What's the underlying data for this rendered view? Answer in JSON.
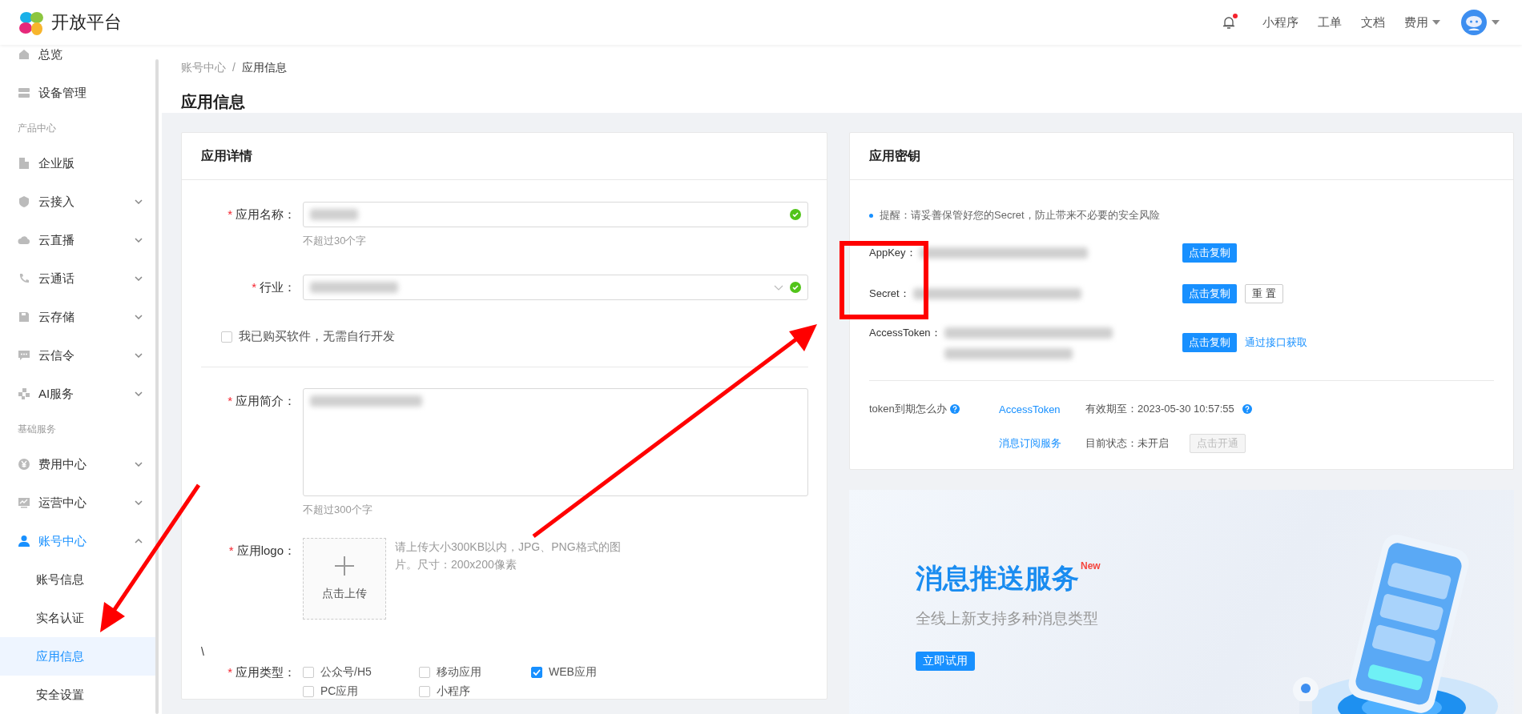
{
  "header": {
    "logo_text": "开放平台",
    "bell": {
      "unread": true
    },
    "nav": [
      {
        "label": "小程序",
        "dropdown": false
      },
      {
        "label": "工单",
        "dropdown": false
      },
      {
        "label": "文档",
        "dropdown": false
      },
      {
        "label": "费用",
        "dropdown": true
      }
    ],
    "avatar": {
      "dropdown": true
    }
  },
  "sidebar": {
    "items": [
      {
        "kind": "item",
        "label": "总览"
      },
      {
        "kind": "item",
        "label": "设备管理"
      },
      {
        "kind": "section",
        "label": "产品中心"
      },
      {
        "kind": "item",
        "label": "企业版"
      },
      {
        "kind": "item",
        "label": "云接入",
        "expanded": false
      },
      {
        "kind": "item",
        "label": "云直播",
        "expanded": false
      },
      {
        "kind": "item",
        "label": "云通话",
        "expanded": false
      },
      {
        "kind": "item",
        "label": "云存储",
        "expanded": false
      },
      {
        "kind": "item",
        "label": "云信令",
        "expanded": false
      },
      {
        "kind": "item",
        "label": "AI服务",
        "expanded": false
      },
      {
        "kind": "section",
        "label": "基础服务"
      },
      {
        "kind": "item",
        "label": "费用中心",
        "expanded": false
      },
      {
        "kind": "item",
        "label": "运营中心",
        "expanded": false
      },
      {
        "kind": "item",
        "label": "账号中心",
        "expanded": true,
        "children": [
          {
            "label": "账号信息",
            "selected": false
          },
          {
            "label": "实名认证",
            "selected": false
          },
          {
            "label": "应用信息",
            "selected": true
          },
          {
            "label": "安全设置",
            "selected": false
          }
        ]
      }
    ]
  },
  "breadcrumb": {
    "items": [
      "账号中心",
      "应用信息"
    ],
    "separator": "/"
  },
  "page_title": "应用信息",
  "app_details": {
    "title": "应用详情",
    "name_field": {
      "required_mark": "*",
      "label": "应用名称：",
      "valid": true,
      "hint": "不超过30个字"
    },
    "industry_field": {
      "required_mark": "*",
      "label": "行业：",
      "valid": true
    },
    "purchased": {
      "label": "我已购买软件，无需自行开发",
      "checked": false
    },
    "intro_field": {
      "required_mark": "*",
      "label": "应用简介：",
      "hint": "不超过300个字"
    },
    "logo_field": {
      "required_mark": "*",
      "label": "应用logo：",
      "upload_label": "点击上传",
      "hint": "请上传大小300KB以内，JPG、PNG格式的图片。尺寸：200x200像素"
    },
    "stray_text": "\\",
    "type_field": {
      "required_mark": "*",
      "label": "应用类型：",
      "options": [
        {
          "label": "公众号/H5",
          "checked": false
        },
        {
          "label": "移动应用",
          "checked": false
        },
        {
          "label": "WEB应用",
          "checked": true
        },
        {
          "label": "PC应用",
          "checked": false
        },
        {
          "label": "小程序",
          "checked": false
        }
      ]
    }
  },
  "app_keys": {
    "title": "应用密钥",
    "notice": "提醒：请妥善保管好您的Secret，防止带来不必要的安全风险",
    "rows": [
      {
        "label": "AppKey：",
        "actions": [
          {
            "kind": "primary",
            "label": "点击复制"
          }
        ]
      },
      {
        "label": "Secret：",
        "actions": [
          {
            "kind": "primary",
            "label": "点击复制"
          },
          {
            "kind": "default",
            "label": "重 置"
          }
        ]
      },
      {
        "label": "AccessToken：",
        "actions": [
          {
            "kind": "primary",
            "label": "点击复制"
          },
          {
            "kind": "link",
            "label": "通过接口获取"
          }
        ]
      }
    ],
    "token": {
      "question": "token到期怎么办",
      "question_help": true,
      "services": [
        {
          "name": "AccessToken",
          "status": "有效期至：2023-05-30 10:57:55",
          "help": true
        },
        {
          "name": "消息订阅服务",
          "status": "目前状态：未开启",
          "help": false,
          "action": {
            "label": "点击开通",
            "disabled": true
          }
        }
      ]
    }
  },
  "banner": {
    "title": "消息推送服务",
    "badge": "New",
    "subtitle": "全线上新支持多种消息类型",
    "button": "立即试用"
  }
}
